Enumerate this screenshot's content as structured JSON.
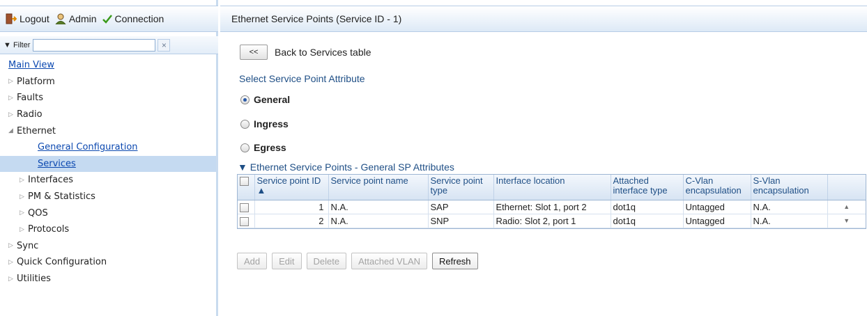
{
  "topbar": {
    "logout_label": "Logout",
    "admin_label": "Admin",
    "connection_label": "Connection"
  },
  "filter": {
    "label": "▼ Filter",
    "value": "",
    "clear_icon": "×"
  },
  "nav": {
    "items": [
      {
        "label": "Main View"
      },
      {
        "label": "Platform"
      },
      {
        "label": "Faults"
      },
      {
        "label": "Radio"
      },
      {
        "label": "Ethernet"
      },
      {
        "label": "General Configuration"
      },
      {
        "label": "Services"
      },
      {
        "label": "Interfaces"
      },
      {
        "label": "PM & Statistics"
      },
      {
        "label": "QOS"
      },
      {
        "label": "Protocols"
      },
      {
        "label": "Sync"
      },
      {
        "label": "Quick Configuration"
      },
      {
        "label": "Utilities"
      }
    ]
  },
  "main": {
    "header_title": "Ethernet Service Points (Service ID - 1)",
    "back_button": "<<",
    "back_label": "Back to Services table",
    "select_title": "Select Service Point Attribute",
    "radios": [
      {
        "label": "General",
        "checked": true
      },
      {
        "label": "Ingress",
        "checked": false
      },
      {
        "label": "Egress",
        "checked": false
      }
    ],
    "table_title": "▼ Ethernet Service Points - General SP Attributes",
    "table": {
      "columns": [
        "Service point ID ▲",
        "Service point name",
        "Service point type",
        "Interface location",
        "Attached interface type",
        "C-Vlan encapsulation",
        "S-Vlan encapsulation"
      ],
      "rows": [
        [
          "1",
          "N.A.",
          "SAP",
          "Ethernet: Slot 1, port 2",
          "dot1q",
          "Untagged",
          "N.A."
        ],
        [
          "2",
          "N.A.",
          "SNP",
          "Radio: Slot 2, port 1",
          "dot1q",
          "Untagged",
          "N.A."
        ]
      ]
    },
    "buttons": {
      "add": "Add",
      "edit": "Edit",
      "delete": "Delete",
      "attached_vlan": "Attached VLAN",
      "refresh": "Refresh"
    }
  },
  "colors": {
    "accent": "#1f4f86",
    "link": "#0b48b0",
    "selected_bg": "#c5daf1",
    "connection_check": "#3a9a1a"
  }
}
